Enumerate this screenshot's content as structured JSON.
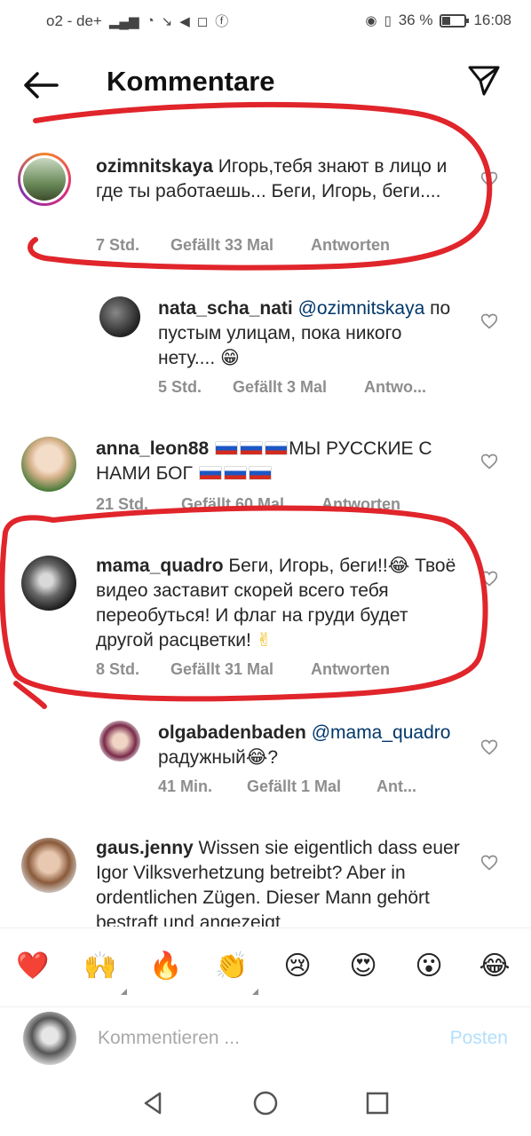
{
  "status_bar": {
    "carrier": "o2 - de+",
    "battery_percent": "36 %",
    "battery_level": 0.36,
    "time": "16:08"
  },
  "header": {
    "title": "Kommentare",
    "back_icon": "arrow-left-icon",
    "share_icon": "paper-plane-icon"
  },
  "comments": [
    {
      "username": "ozimnitskaya",
      "text": "Игорь,тебя знают в лицо и где ты работаешь... Беги, Игорь, беги....",
      "time": "7 Std.",
      "likes": "Gefällt 33 Mal",
      "reply": "Antworten"
    },
    {
      "username": "nata_scha_nati",
      "mention": "@ozimnitskaya",
      "text": "по пустым улицам, пока никого нету....",
      "emoji": "😁",
      "time": "5 Std.",
      "likes": "Gefällt 3 Mal",
      "reply": "Antwo..."
    },
    {
      "username": "anna_leon88",
      "text_a": "МЫ РУССКИЕ  С",
      "text_b": "НАМИ БОГ",
      "time": "21 Std.",
      "likes": "Gefällt 60 Mal",
      "reply": "Antworten"
    },
    {
      "username": "mama_quadro",
      "text": "Беги, Игорь, беги!!",
      "emoji": "😂",
      "text_2": "Твоё видео заставит скорей всего тебя переобуться! И флаг на груди будет другой расцветки!",
      "emoji_2": "✌",
      "time": "8 Std.",
      "likes": "Gefällt 31 Mal",
      "reply": "Antworten"
    },
    {
      "username": "olgabadenbaden",
      "mention": "@mama_quadro",
      "text": "радужный",
      "emoji": "😂",
      "text_end": "?",
      "time": "41 Min.",
      "likes": "Gefällt 1 Mal",
      "reply": "Ant..."
    },
    {
      "username": "gaus.jenny",
      "text": "Wissen sie eigentlich dass euer Igor Vilksverhetzung betreibt? Aber in ordentlichen Zügen. Dieser Mann gehört bestraft und angezeigt"
    }
  ],
  "reactions": [
    "❤️",
    "🙌",
    "🔥",
    "👏",
    "😢",
    "😍",
    "😮",
    "😂"
  ],
  "compose": {
    "placeholder": "Kommentieren ...",
    "post_label": "Posten"
  },
  "colors": {
    "annotation_red": "#e0252b",
    "link_blue": "#00376b",
    "post_blue": "#b2dffc",
    "meta_gray": "#8e8e8e"
  }
}
